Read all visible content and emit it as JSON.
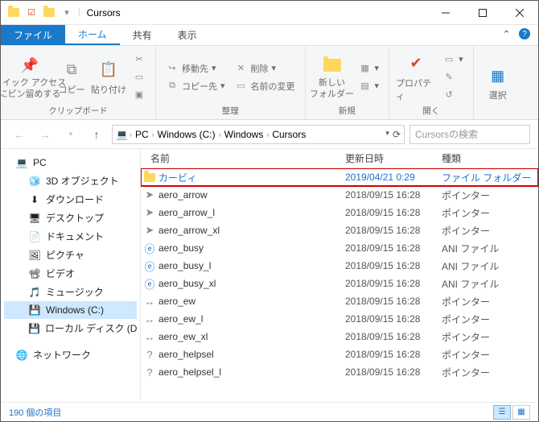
{
  "titlebar": {
    "title": "Cursors"
  },
  "ribbon_tabs": {
    "file": "ファイル",
    "home": "ホーム",
    "share": "共有",
    "view": "表示"
  },
  "ribbon": {
    "clipboard": {
      "pin": "クイック アクセス\nにピン留めする",
      "copy": "コピー",
      "paste": "貼り付け",
      "label": "クリップボード"
    },
    "organize": {
      "move": "移動先",
      "copyto": "コピー先",
      "delete": "削除",
      "rename": "名前の変更",
      "label": "整理"
    },
    "new": {
      "folder": "新しい\nフォルダー",
      "label": "新規"
    },
    "open": {
      "properties": "プロパティ",
      "label": "開く"
    },
    "select": {
      "btn": "選択"
    }
  },
  "breadcrumb": [
    "PC",
    "Windows (C:)",
    "Windows",
    "Cursors"
  ],
  "search_placeholder": "Cursorsの検索",
  "tree": {
    "pc": "PC",
    "items": [
      "3D オブジェクト",
      "ダウンロード",
      "デスクトップ",
      "ドキュメント",
      "ピクチャ",
      "ビデオ",
      "ミュージック",
      "Windows (C:)",
      "ローカル ディスク (D"
    ],
    "network": "ネットワーク"
  },
  "columns": {
    "name": "名前",
    "date": "更新日時",
    "type": "種類"
  },
  "files": [
    {
      "icon": "folder",
      "name": "カービィ",
      "date": "2019/04/21 0:29",
      "type": "ファイル フォルダー",
      "hl": true
    },
    {
      "icon": "cursor",
      "name": "aero_arrow",
      "date": "2018/09/15 16:28",
      "type": "ポインター"
    },
    {
      "icon": "cursor",
      "name": "aero_arrow_l",
      "date": "2018/09/15 16:28",
      "type": "ポインター"
    },
    {
      "icon": "cursor",
      "name": "aero_arrow_xl",
      "date": "2018/09/15 16:28",
      "type": "ポインター"
    },
    {
      "icon": "ani",
      "name": "aero_busy",
      "date": "2018/09/15 16:28",
      "type": "ANI ファイル"
    },
    {
      "icon": "ani",
      "name": "aero_busy_l",
      "date": "2018/09/15 16:28",
      "type": "ANI ファイル"
    },
    {
      "icon": "ani",
      "name": "aero_busy_xl",
      "date": "2018/09/15 16:28",
      "type": "ANI ファイル"
    },
    {
      "icon": "resize",
      "name": "aero_ew",
      "date": "2018/09/15 16:28",
      "type": "ポインター"
    },
    {
      "icon": "resize",
      "name": "aero_ew_l",
      "date": "2018/09/15 16:28",
      "type": "ポインター"
    },
    {
      "icon": "resize",
      "name": "aero_ew_xl",
      "date": "2018/09/15 16:28",
      "type": "ポインター"
    },
    {
      "icon": "help",
      "name": "aero_helpsel",
      "date": "2018/09/15 16:28",
      "type": "ポインター"
    },
    {
      "icon": "help",
      "name": "aero_helpsel_l",
      "date": "2018/09/15 16:28",
      "type": "ポインター"
    }
  ],
  "status": "190 個の項目",
  "tree_icons": [
    "🧊",
    "⬇",
    "🖥",
    "📄",
    "🖼",
    "📽",
    "🎵",
    "💾",
    "💾"
  ]
}
